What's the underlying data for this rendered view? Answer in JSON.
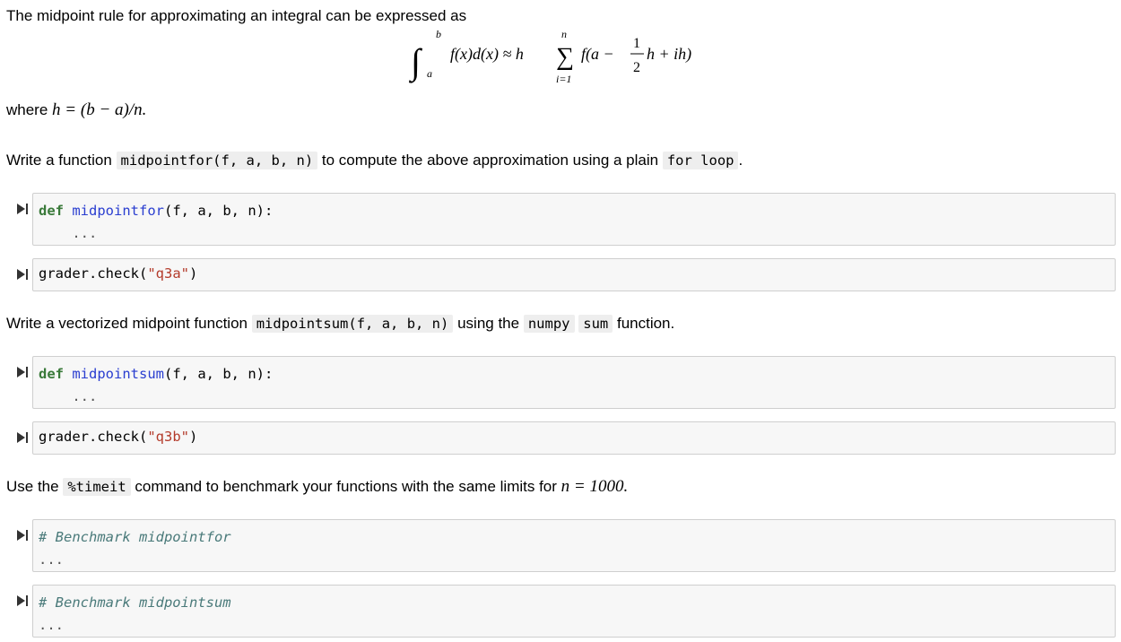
{
  "intro": {
    "text": "The midpoint rule for approximating an integral can be expressed as"
  },
  "formula": {
    "integral": "∫",
    "upper": "b",
    "lower": "a",
    "integrand": "f(x)d(x) ≈ h",
    "sum": "∑",
    "sum_upper": "n",
    "sum_lower": "i=1",
    "term_start": "f(a −",
    "frac_num": "1",
    "frac_den": "2",
    "term_end": "h + ih)"
  },
  "where": {
    "prefix": "where",
    "expr": "h = (b − a)/n."
  },
  "task_a": {
    "pre": "Write a function",
    "code": "midpointfor(f, a, b, n)",
    "mid": "to compute the above approximation using a plain",
    "code2": "for loop",
    "post": "."
  },
  "cell1": {
    "kw": "def",
    "fn": "midpointfor",
    "args": "(f, a, b, n):",
    "body": "    ..."
  },
  "cell2": {
    "pre": "grader.check(",
    "str": "\"q3a\"",
    "post": ")"
  },
  "task_b": {
    "pre": "Write a vectorized midpoint function",
    "code": "midpointsum(f, a, b, n)",
    "mid": "using the",
    "code2": "numpy",
    "code3": "sum",
    "post": "function."
  },
  "cell3": {
    "kw": "def",
    "fn": "midpointsum",
    "args": "(f, a, b, n):",
    "body": "    ..."
  },
  "cell4": {
    "pre": "grader.check(",
    "str": "\"q3b\"",
    "post": ")"
  },
  "task_c": {
    "pre": "Use the",
    "code": "%timeit",
    "mid": "command to benchmark your functions with the same limits for",
    "math": "n = 1000."
  },
  "cell5": {
    "comment": "# Benchmark midpointfor",
    "body": "..."
  },
  "cell6": {
    "comment": "# Benchmark midpointsum",
    "body": "..."
  }
}
